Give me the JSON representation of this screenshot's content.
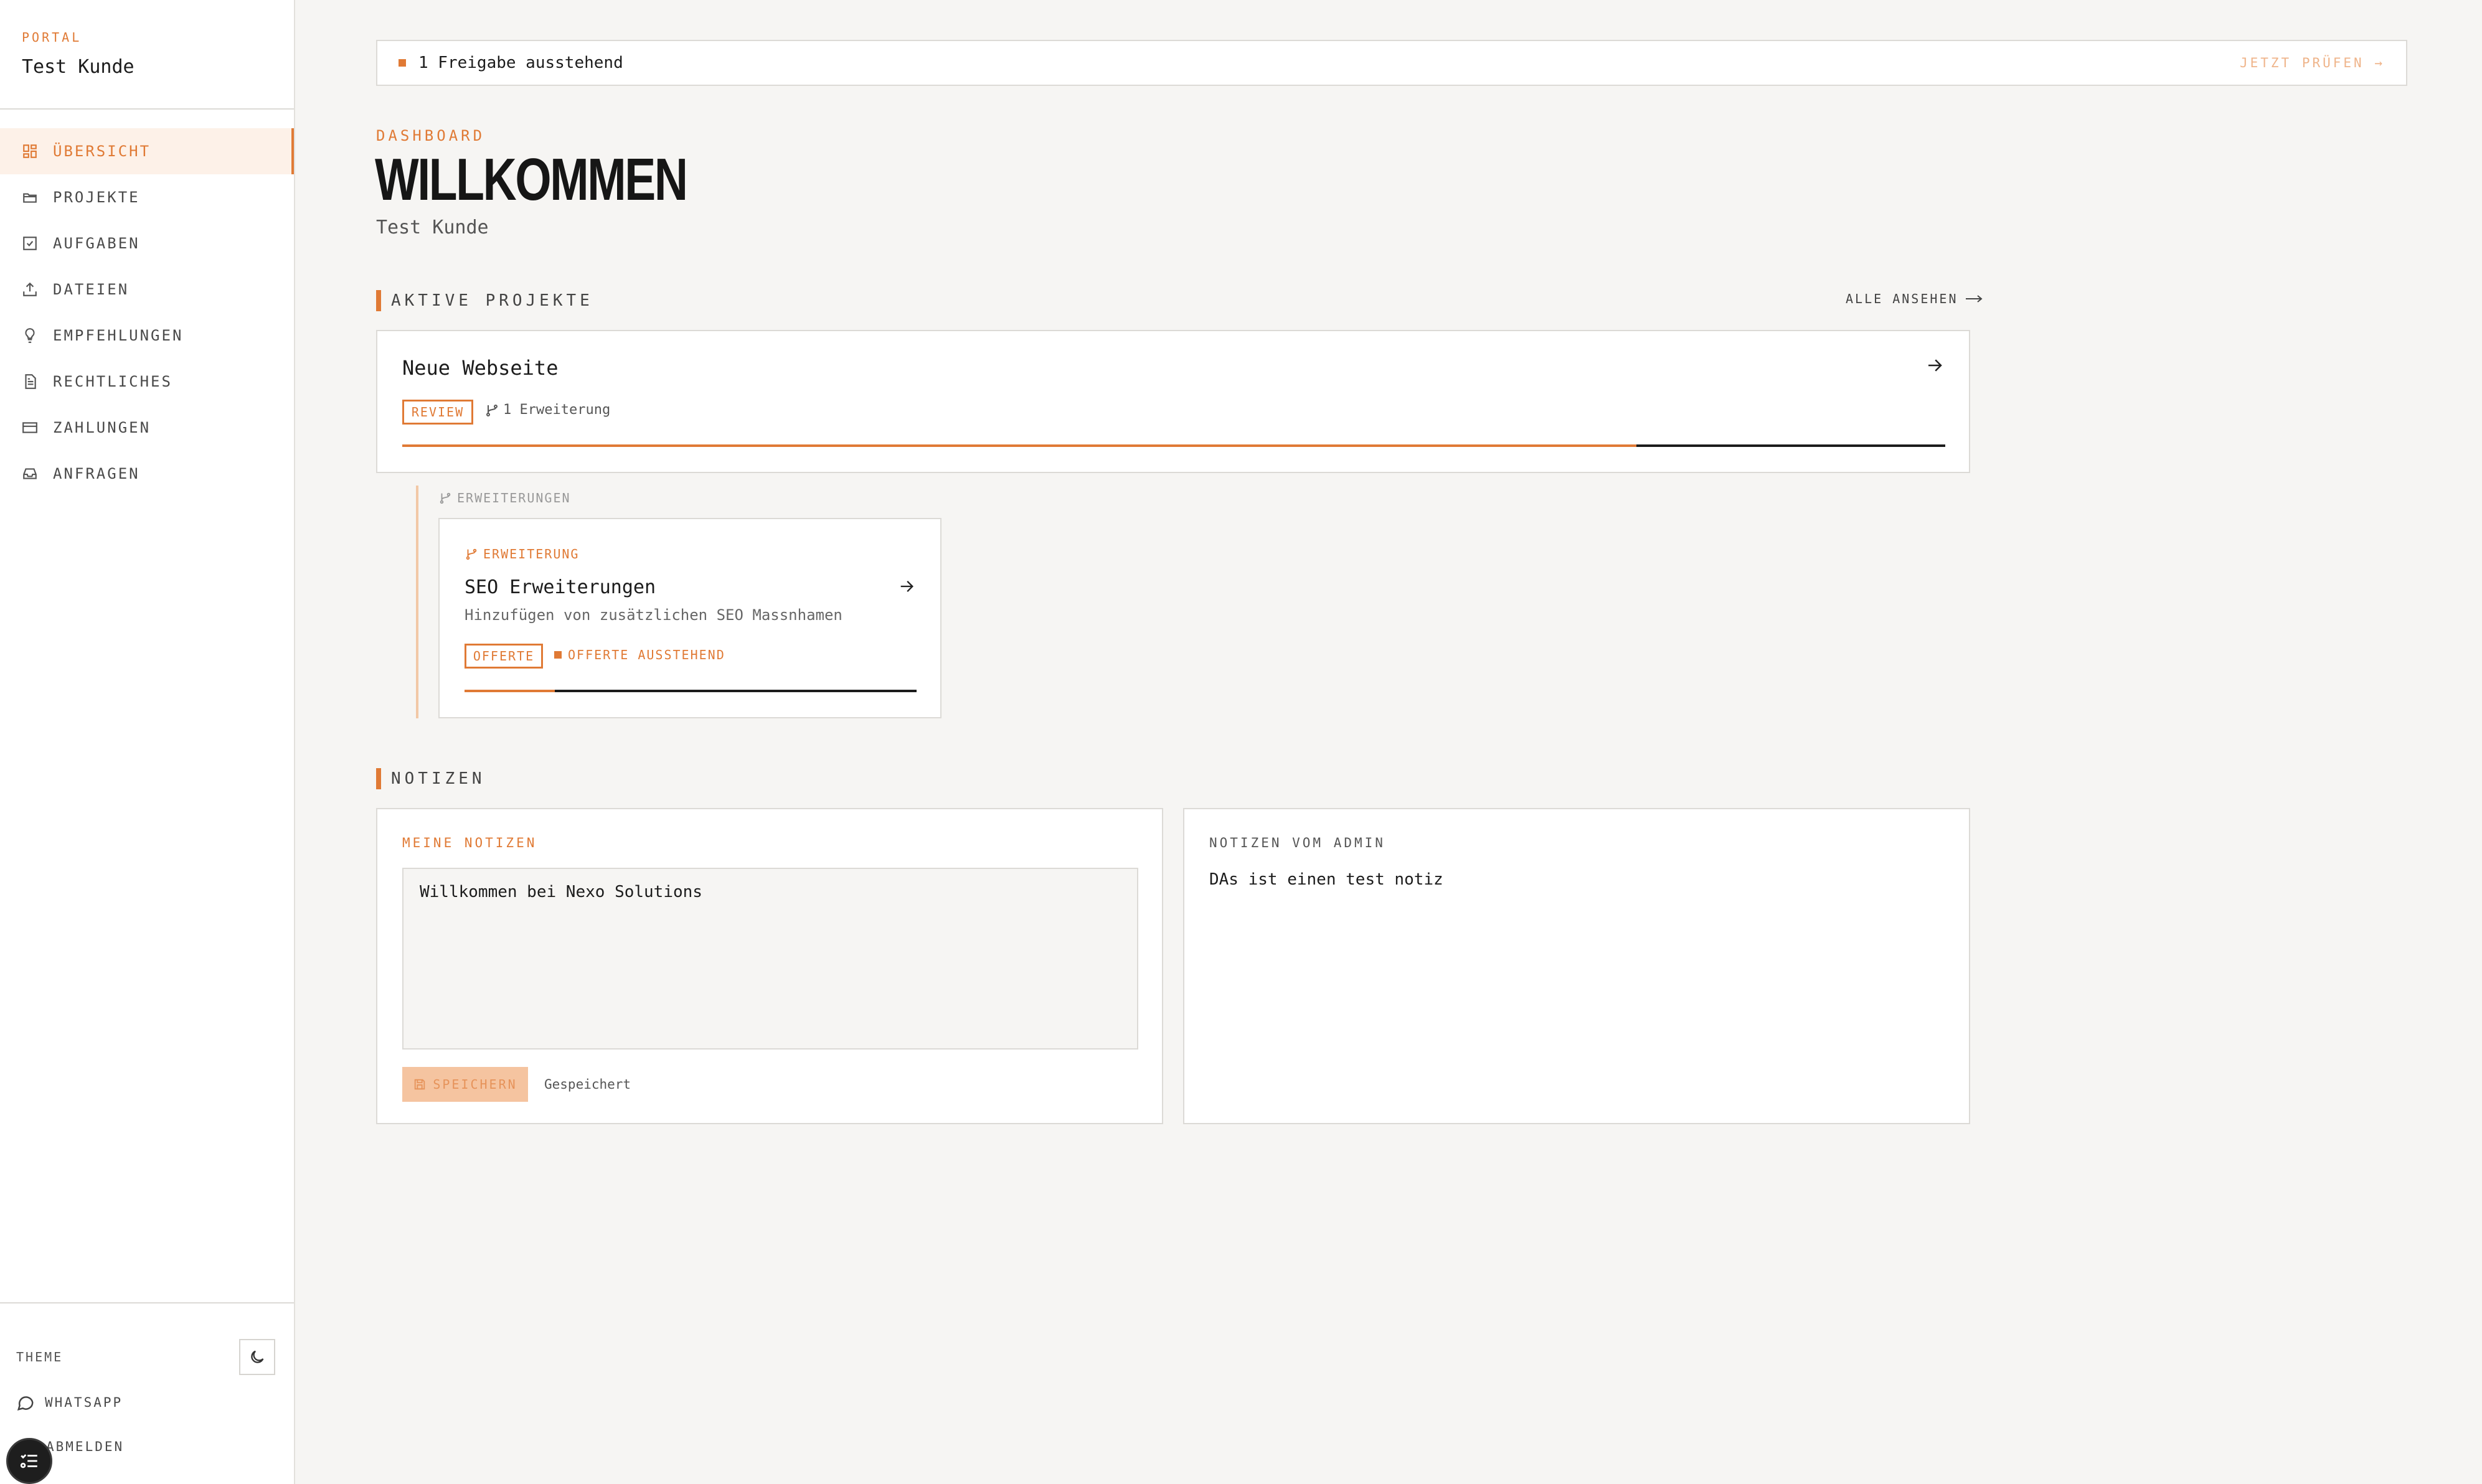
{
  "sidebar": {
    "eyebrow": "PORTAL",
    "client_name": "Test Kunde",
    "items": [
      {
        "label": "ÜBERSICHT",
        "icon": "dashboard-icon",
        "active": true
      },
      {
        "label": "PROJEKTE",
        "icon": "folder-icon"
      },
      {
        "label": "AUFGABEN",
        "icon": "checkbox-icon"
      },
      {
        "label": "DATEIEN",
        "icon": "upload-icon"
      },
      {
        "label": "EMPFEHLUNGEN",
        "icon": "lightbulb-icon"
      },
      {
        "label": "RECHTLICHES",
        "icon": "document-icon"
      },
      {
        "label": "ZAHLUNGEN",
        "icon": "credit-card-icon"
      },
      {
        "label": "ANFRAGEN",
        "icon": "inbox-icon"
      }
    ],
    "theme_label": "THEME",
    "whatsapp_label": "WHATSAPP",
    "logout_label": "ABMELDEN"
  },
  "banner": {
    "text": "1 Freigabe ausstehend",
    "cta": "JETZT PRÜFEN →"
  },
  "header": {
    "eyebrow": "DASHBOARD",
    "title": "WILLKOMMEN",
    "subtitle": "Test Kunde"
  },
  "projects": {
    "section_title": "AKTIVE PROJEKTE",
    "see_all": "ALLE ANSEHEN",
    "items": [
      {
        "name": "Neue Webseite",
        "status": "REVIEW",
        "extensions": "1 Erweiterung",
        "progress": 0.8
      }
    ]
  },
  "extensions": {
    "label": "ERWEITERUNGEN",
    "items": [
      {
        "eyebrow": "ERWEITERUNG",
        "name": "SEO Erweiterungen",
        "description": "Hinzufügen von zusätzlichen SEO Massnhamen",
        "status": "OFFERTE",
        "status_detail": "OFFERTE AUSSTEHEND",
        "progress": 0.2
      }
    ]
  },
  "notes": {
    "section_title": "NOTIZEN",
    "mine": {
      "title": "MEINE NOTIZEN",
      "content": "Willkommen bei Nexo Solutions",
      "save_label": "SPEICHERN",
      "saved_text": "Gespeichert"
    },
    "admin": {
      "title": "NOTIZEN VOM ADMIN",
      "content": "DAs ist einen test notiz"
    }
  },
  "colors": {
    "accent": "#e07a35",
    "background": "#f6f5f3"
  }
}
